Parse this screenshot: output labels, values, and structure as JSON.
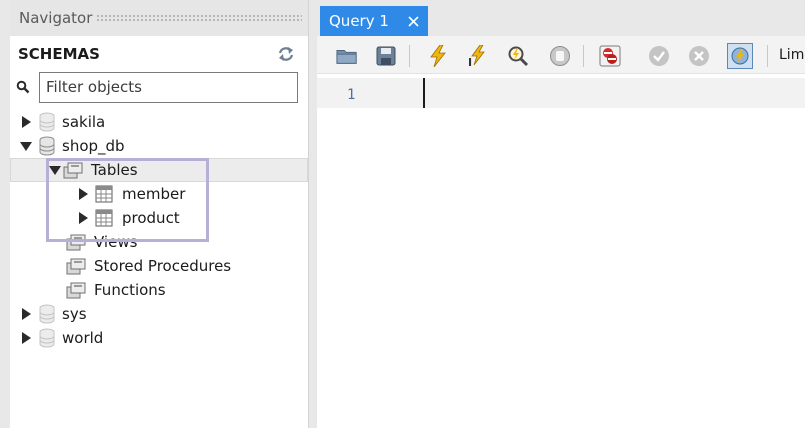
{
  "navigator": {
    "title": "Navigator",
    "schemas_title": "SCHEMAS",
    "filter": {
      "placeholder": "Filter objects",
      "value": ""
    },
    "tree": {
      "sakila": "sakila",
      "shop_db": "shop_db",
      "tables": "Tables",
      "member": "member",
      "product": "product",
      "views": "Views",
      "stored_procedures": "Stored Procedures",
      "functions": "Functions",
      "sys": "sys",
      "world": "world"
    },
    "icons": {
      "refresh": "refresh-icon",
      "search": "search-icon",
      "database": "database-icon",
      "folder": "folder-icon",
      "table": "table-icon"
    }
  },
  "query": {
    "tab_label": "Query 1",
    "toolbar": {
      "icons": [
        "open-folder-icon",
        "save-icon",
        "execute-lightning-icon",
        "execute-current-icon",
        "explain-magnifier-icon",
        "stop-icon",
        "toggle-error-stop-icon",
        "commit-check-icon",
        "rollback-icon",
        "autocommit-icon"
      ],
      "limit_label": "Limi"
    },
    "editor": {
      "line_number": "1",
      "content": ""
    }
  },
  "colors": {
    "tab_active": "#2e8ae6",
    "highlight_box": "#b9afd6",
    "panel_bg": "#e8e8e8"
  }
}
